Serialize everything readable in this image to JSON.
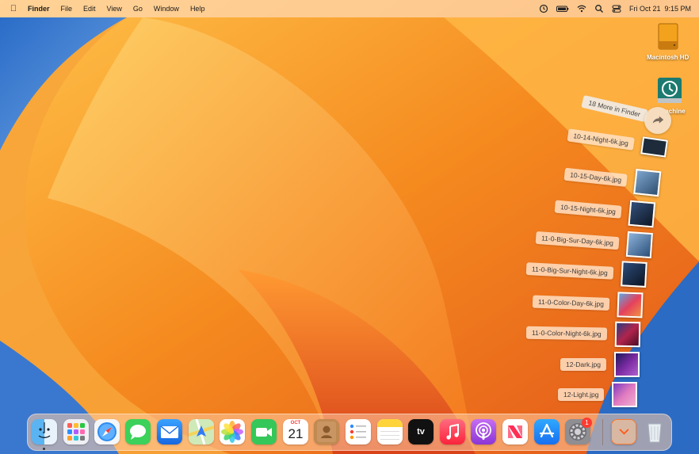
{
  "menubar": {
    "app_name": "Finder",
    "menus": [
      "File",
      "Edit",
      "View",
      "Go",
      "Window",
      "Help"
    ],
    "status_icons": [
      "clock-icon",
      "battery-icon",
      "wifi-icon",
      "search-icon",
      "control-center-icon"
    ],
    "clock": "Fri Oct 21  9:15 PM"
  },
  "desktop": {
    "icons": [
      {
        "name": "Macintosh HD"
      },
      {
        "name": "Time Machine",
        "visible_label": "achine"
      }
    ]
  },
  "stack": {
    "more_label": "18 More in Finder",
    "more_icon": "share-arrow-icon",
    "items": [
      {
        "label": "10-14-Night-6k.jpg",
        "thumb_color": "#1d2b3a"
      },
      {
        "label": "10-15-Day-6k.jpg",
        "thumb_color": "#4a78a6"
      },
      {
        "label": "10-15-Night-6k.jpg",
        "thumb_color": "#1e2d44"
      },
      {
        "label": "11-0-Big-Sur-Day-6k.jpg",
        "thumb_color": "#5a86b8"
      },
      {
        "label": "11-0-Big-Sur-Night-6k.jpg",
        "thumb_color": "#1a2a48"
      },
      {
        "label": "11-0-Color-Day-6k.jpg",
        "thumb_color": "#e05a6c"
      },
      {
        "label": "11-0-Color-Night-6k.jpg",
        "thumb_color": "#7a1e3c"
      },
      {
        "label": "12-Dark.jpg",
        "thumb_color": "#4a1a7a"
      },
      {
        "label": "12-Light.jpg",
        "thumb_color": "#b560b0"
      }
    ]
  },
  "dock": {
    "apps": [
      {
        "name": "Finder",
        "icon": "finder-icon"
      },
      {
        "name": "Launchpad",
        "icon": "launchpad-icon"
      },
      {
        "name": "Safari",
        "icon": "safari-icon"
      },
      {
        "name": "Messages",
        "icon": "messages-icon"
      },
      {
        "name": "Mail",
        "icon": "mail-icon"
      },
      {
        "name": "Maps",
        "icon": "maps-icon"
      },
      {
        "name": "Photos",
        "icon": "photos-icon"
      },
      {
        "name": "FaceTime",
        "icon": "facetime-icon"
      },
      {
        "name": "Calendar",
        "icon": "calendar-icon",
        "month": "OCT",
        "day": "21"
      },
      {
        "name": "Contacts",
        "icon": "contacts-icon"
      },
      {
        "name": "Reminders",
        "icon": "reminders-icon"
      },
      {
        "name": "Notes",
        "icon": "notes-icon"
      },
      {
        "name": "TV",
        "icon": "tv-icon",
        "label": "tv"
      },
      {
        "name": "Music",
        "icon": "music-icon"
      },
      {
        "name": "Podcasts",
        "icon": "podcasts-icon"
      },
      {
        "name": "News",
        "icon": "news-icon"
      },
      {
        "name": "App Store",
        "icon": "app-store-icon"
      },
      {
        "name": "System Settings",
        "icon": "settings-icon",
        "badge": "1"
      },
      {
        "name": "Downloads",
        "icon": "downloads-stack-icon"
      },
      {
        "name": "Trash",
        "icon": "trash-icon"
      }
    ]
  }
}
